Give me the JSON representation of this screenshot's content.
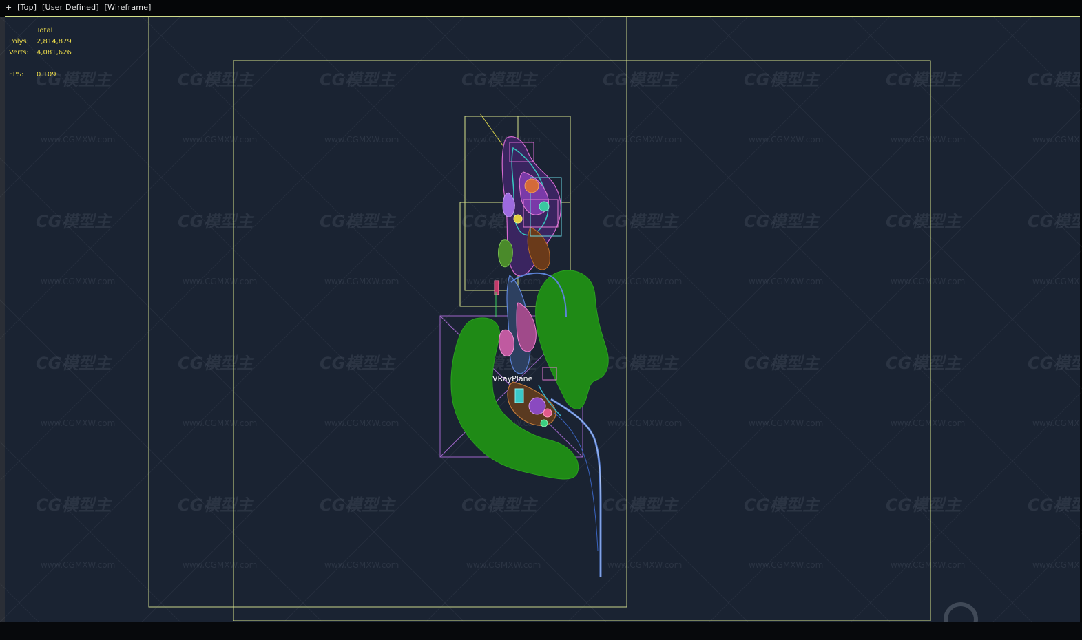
{
  "viewport": {
    "menu": [
      "+",
      "[Top]",
      "[User Defined]",
      "[Wireframe]"
    ],
    "object_label": "VRayPlane"
  },
  "stats": {
    "header": "Total",
    "polys_label": "Polys:",
    "polys_value": "2,814,879",
    "verts_label": "Verts:",
    "verts_value": "4,081,626",
    "fps_label": "FPS:",
    "fps_value": "0.109"
  },
  "watermark": {
    "logo_text": "CG模型主",
    "url_text": "www.CGMXW.com"
  },
  "colors": {
    "viewport_bg": "#1a2332",
    "frame_outline": "#d6e28a",
    "stats_text": "#e8d84a",
    "terrain_green": "#1f8a16",
    "road_blue": "#5d84d8",
    "selection_purple": "#9f66c8"
  }
}
